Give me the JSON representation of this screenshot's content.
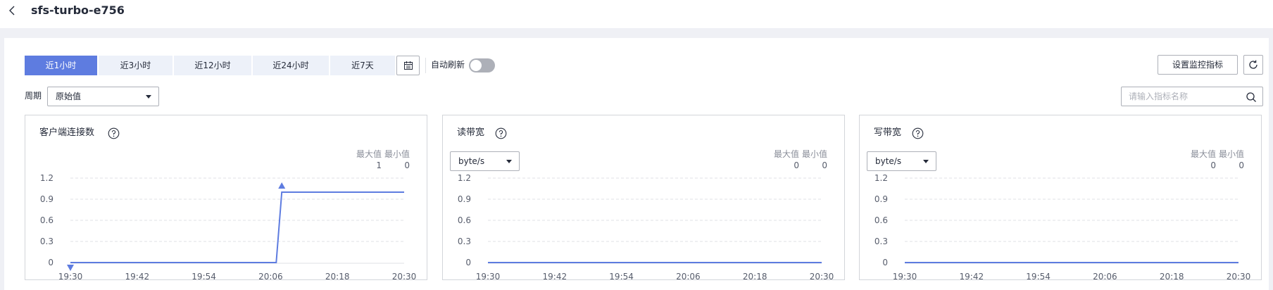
{
  "header": {
    "title": "sfs-turbo-e756"
  },
  "toolbar": {
    "tabs": [
      {
        "label": "近1小时",
        "active": true
      },
      {
        "label": "近3小时",
        "active": false
      },
      {
        "label": "近12小时",
        "active": false
      },
      {
        "label": "近24小时",
        "active": false
      },
      {
        "label": "近7天",
        "active": false
      }
    ],
    "auto_refresh_label": "自动刷新",
    "auto_refresh_on": false,
    "set_metrics_label": "设置监控指标",
    "period_label": "周期",
    "period_value": "原始值",
    "search_placeholder": "请输入指标名称"
  },
  "cards": [
    {
      "title": "客户端连接数",
      "unit": "",
      "max_label": "最大值",
      "min_label": "最小值",
      "max": "1",
      "min": "0"
    },
    {
      "title": "读带宽",
      "unit": "byte/s",
      "max_label": "最大值",
      "min_label": "最小值",
      "max": "0",
      "min": "0"
    },
    {
      "title": "写带宽",
      "unit": "byte/s",
      "max_label": "最大值",
      "min_label": "最小值",
      "max": "0",
      "min": "0"
    }
  ],
  "chart_data": [
    {
      "type": "line",
      "title": "客户端连接数",
      "x": [
        "19:30",
        "20:07",
        "20:08",
        "20:30"
      ],
      "series": [
        {
          "values": [
            0,
            0,
            1,
            1
          ]
        }
      ],
      "xticks": [
        "19:30",
        "19:42",
        "19:54",
        "20:06",
        "20:18",
        "20:30"
      ],
      "yticks": [
        "1.2",
        "0.9",
        "0.6",
        "0.3",
        "0"
      ],
      "ylim": [
        0,
        1.2
      ],
      "grid": true,
      "markers": {
        "max": "20:08",
        "min": "19:30"
      },
      "color": "#5e7ce0"
    },
    {
      "type": "line",
      "title": "读带宽",
      "x": [
        "19:30",
        "20:30"
      ],
      "series": [
        {
          "values": [
            0,
            0
          ]
        }
      ],
      "xticks": [
        "19:30",
        "19:42",
        "19:54",
        "20:06",
        "20:18",
        "20:30"
      ],
      "yticks": [
        "1.2",
        "0.9",
        "0.6",
        "0.3",
        "0"
      ],
      "ylim": [
        0,
        1.2
      ],
      "grid": true,
      "color": "#5e7ce0"
    },
    {
      "type": "line",
      "title": "写带宽",
      "x": [
        "19:30",
        "20:30"
      ],
      "series": [
        {
          "values": [
            0,
            0
          ]
        }
      ],
      "xticks": [
        "19:30",
        "19:42",
        "19:54",
        "20:06",
        "20:18",
        "20:30"
      ],
      "yticks": [
        "1.2",
        "0.9",
        "0.6",
        "0.3",
        "0"
      ],
      "ylim": [
        0,
        1.2
      ],
      "grid": true,
      "color": "#5e7ce0"
    }
  ]
}
